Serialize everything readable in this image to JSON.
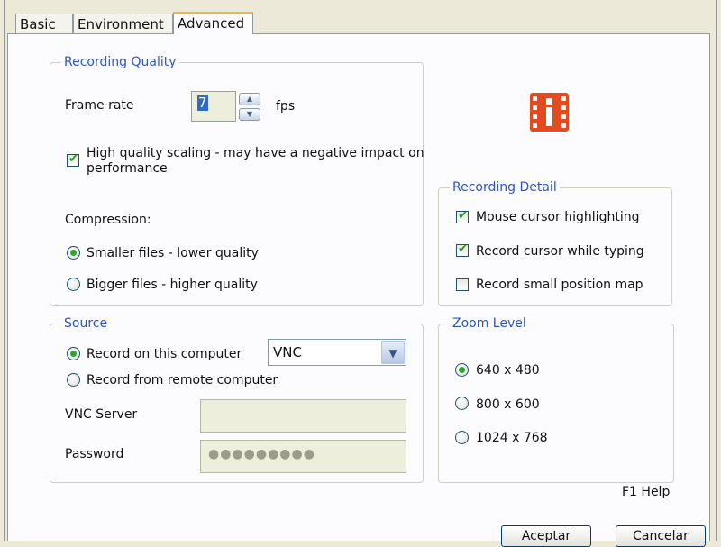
{
  "tabs": [
    {
      "label": "Basic",
      "active": false
    },
    {
      "label": "Environment",
      "active": false
    },
    {
      "label": "Advanced",
      "active": true
    }
  ],
  "recording_quality": {
    "legend": "Recording Quality",
    "frame_rate_label": "Frame rate",
    "frame_rate_value": "7",
    "frame_rate_unit": "fps",
    "high_quality_scaling": {
      "label_line1": "High quality scaling - may have a negative impact on",
      "label_line2": "performance",
      "checked": true
    },
    "compression_label": "Compression:",
    "compression_options": [
      {
        "label": "Smaller files - lower quality",
        "selected": true
      },
      {
        "label": "Bigger files - higher quality",
        "selected": false
      }
    ]
  },
  "recording_detail": {
    "legend": "Recording Detail",
    "options": [
      {
        "label": "Mouse cursor highlighting",
        "checked": true
      },
      {
        "label": "Record cursor while typing",
        "checked": true
      },
      {
        "label": "Record small position map",
        "checked": false
      }
    ]
  },
  "source": {
    "legend": "Source",
    "options": [
      {
        "label": "Record on this computer",
        "selected": true
      },
      {
        "label": "Record from remote computer",
        "selected": false
      }
    ],
    "protocol_value": "VNC",
    "vnc_server_label": "VNC Server",
    "vnc_server_value": "",
    "password_label": "Password",
    "password_value": "●●●●●●●●●"
  },
  "zoom_level": {
    "legend": "Zoom Level",
    "options": [
      {
        "label": "640 x 480",
        "selected": true
      },
      {
        "label": "800 x 600",
        "selected": false
      },
      {
        "label": "1024 x 768",
        "selected": false
      }
    ]
  },
  "help_text": "F1 Help",
  "buttons": {
    "ok_label": "Aceptar",
    "cancel_label": "Cancelar"
  },
  "icons": {
    "info": "info-film-icon",
    "spin_up": "chevron-up-icon",
    "spin_down": "chevron-down-icon",
    "dropdown": "chevron-down-icon"
  },
  "colors": {
    "legend": "#2b55c7",
    "check": "#21a121",
    "tab_accent": "#f7b23b",
    "info_icon": "#e24a1f"
  }
}
